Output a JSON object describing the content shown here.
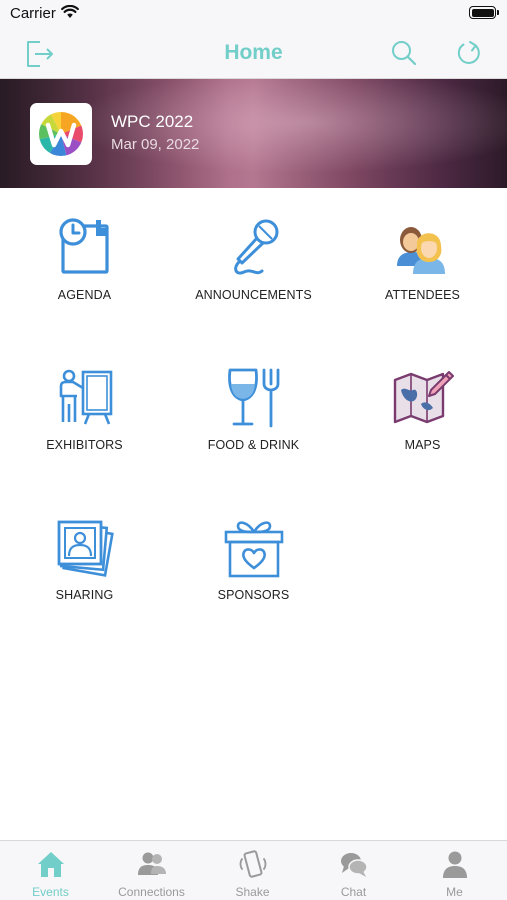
{
  "status_bar": {
    "carrier": "Carrier"
  },
  "nav": {
    "title": "Home",
    "accent": "#72cec9"
  },
  "event": {
    "name": "WPC 2022",
    "date": "Mar 09, 2022"
  },
  "menu": [
    {
      "label": "AGENDA",
      "icon": "calendar-clock-icon"
    },
    {
      "label": "ANNOUNCEMENTS",
      "icon": "microphone-icon"
    },
    {
      "label": "ATTENDEES",
      "icon": "people-icon"
    },
    {
      "label": "EXHIBITORS",
      "icon": "presenter-icon"
    },
    {
      "label": "FOOD & DRINK",
      "icon": "glass-fork-icon"
    },
    {
      "label": "MAPS",
      "icon": "map-pencil-icon"
    },
    {
      "label": "SHARING",
      "icon": "photos-icon"
    },
    {
      "label": "SPONSORS",
      "icon": "gift-icon"
    }
  ],
  "tabs": [
    {
      "label": "Events",
      "icon": "home-icon",
      "active": true
    },
    {
      "label": "Connections",
      "icon": "connections-icon",
      "active": false
    },
    {
      "label": "Shake",
      "icon": "shake-phone-icon",
      "active": false
    },
    {
      "label": "Chat",
      "icon": "chat-icon",
      "active": false
    },
    {
      "label": "Me",
      "icon": "person-icon",
      "active": false
    }
  ]
}
